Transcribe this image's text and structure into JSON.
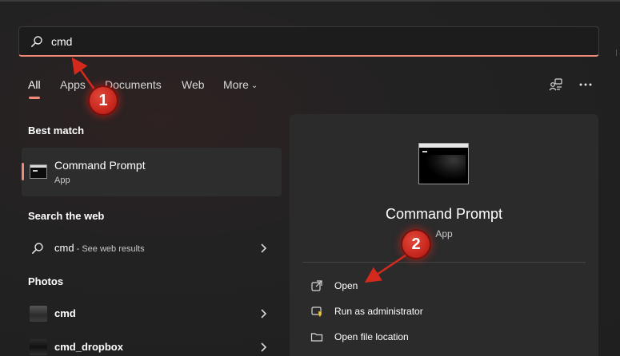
{
  "search": {
    "value": "cmd",
    "placeholder": ""
  },
  "tabs": [
    {
      "label": "All",
      "active": true
    },
    {
      "label": "Apps"
    },
    {
      "label": "Documents"
    },
    {
      "label": "Web"
    },
    {
      "label": "More"
    }
  ],
  "sections": {
    "best_match": "Best match",
    "search_web": "Search the web",
    "photos": "Photos"
  },
  "best_match": {
    "title": "Command Prompt",
    "subtitle": "App"
  },
  "web_result": {
    "query": "cmd",
    "suffix": " - See web results"
  },
  "photos": [
    {
      "label": "cmd"
    },
    {
      "label": "cmd_dropbox"
    }
  ],
  "detail": {
    "title": "Command Prompt",
    "subtitle": "App",
    "actions": [
      {
        "label": "Open",
        "icon": "open-external-icon"
      },
      {
        "label": "Run as administrator",
        "icon": "shield-admin-icon"
      },
      {
        "label": "Open file location",
        "icon": "folder-icon"
      }
    ]
  },
  "callouts": [
    {
      "number": "1"
    },
    {
      "number": "2"
    }
  ],
  "colors": {
    "accent": "#f08a78",
    "callout": "#d1271c",
    "panel": "#2b2b2b",
    "background": "#202020"
  }
}
